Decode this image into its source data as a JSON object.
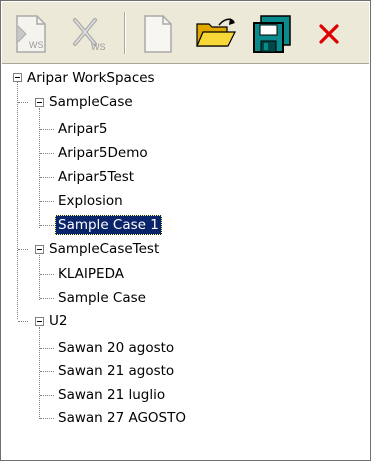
{
  "toolbar": {
    "buttons": [
      {
        "name": "load-workspace-button",
        "icon": "load-workspace-icon",
        "enabled": false
      },
      {
        "name": "delete-workspace-button",
        "icon": "delete-workspace-icon",
        "enabled": false
      },
      {
        "name": "new-case-button",
        "icon": "new-document-icon",
        "enabled": false
      },
      {
        "name": "open-case-button",
        "icon": "open-folder-icon",
        "enabled": true
      },
      {
        "name": "save-case-button",
        "icon": "save-floppy-icon",
        "enabled": true
      },
      {
        "name": "delete-case-button",
        "icon": "delete-x-icon",
        "enabled": true
      }
    ],
    "ws_label": "WS"
  },
  "tree": {
    "root": "Aripar WorkSpaces",
    "workspaces": [
      {
        "label": "SampleCase",
        "cases": [
          "Aripar5",
          "Aripar5Demo",
          "Aripar5Test",
          "Explosion",
          "Sample Case 1"
        ]
      },
      {
        "label": "SampleCaseTest",
        "cases": [
          "KLAIPEDA",
          "Sample Case"
        ]
      },
      {
        "label": "U2",
        "cases": [
          "Sawan 20 agosto",
          "Sawan 21 agosto",
          "Sawan 21 luglio",
          "Sawan 27 AGOSTO"
        ]
      }
    ],
    "selected": "Sample Case 1"
  },
  "colors": {
    "toolbar_bg": "#ece9d8",
    "selection_bg": "#0a246a",
    "folder_yellow": "#f2c418",
    "save_teal": "#0a8a8a",
    "delete_red": "#e00000"
  }
}
